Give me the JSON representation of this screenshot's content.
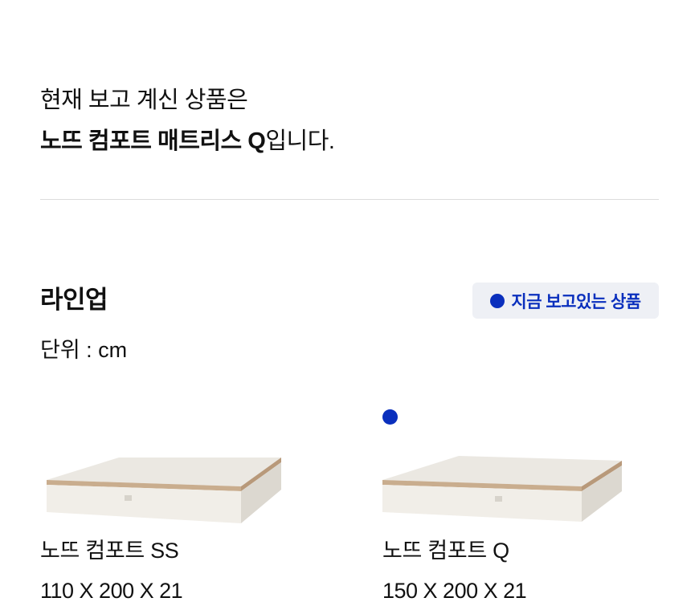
{
  "current": {
    "intro": "현재 보고 계신 상품은",
    "product_name": "노뜨 컴포트 매트리스 Q",
    "suffix": "입니다."
  },
  "lineup": {
    "title": "라인업",
    "unit": "단위 : cm",
    "badge_label": "지금 보고있는 상품",
    "accent_color": "#0a2fbd",
    "products": [
      {
        "name": "노뜨 컴포트 SS",
        "size": "110 X 200 X 21",
        "selected": false
      },
      {
        "name": "노뜨 컴포트 Q",
        "size": "150 X 200 X 21",
        "selected": true
      }
    ]
  }
}
